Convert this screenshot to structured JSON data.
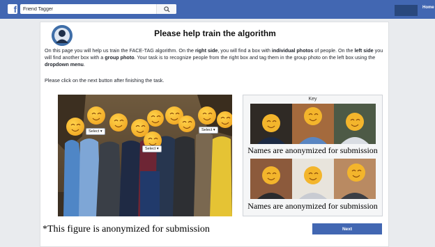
{
  "header": {
    "search_value": "Friend Tagger",
    "home_label": "Home",
    "icons": [
      "facebook-logo",
      "search-icon"
    ]
  },
  "main": {
    "title": "Please help train the algorithm",
    "intro_1": "On this page you will help us train the FACE-TAG algorithm. On the ",
    "right_side": "right side",
    "intro_2": ", you will find a box with ",
    "individual_photos": "individual photos",
    "intro_3": " of people. On the ",
    "left_side": "left side",
    "intro_4": " you will find another box with a ",
    "group_photo": "group photo",
    "intro_5": ". Your task is to recognize people from the right box and tag them in the group photo on the left box using the ",
    "dropdown_menu": "dropdown menu",
    "intro_6": ".",
    "note": "Please click on the next button after finishing the task.",
    "selects": [
      "Select",
      "Select",
      "Select"
    ],
    "key_title": "Key",
    "caption_1": "Names are anonymized for submission",
    "caption_2": "Names are anonymized for submission",
    "footnote": "*This figure is anonymized for submission",
    "next_label": "Next"
  },
  "colors": {
    "topbar": "#4267b2",
    "button": "#4267b2",
    "emoji_face": "#f5b82e"
  }
}
